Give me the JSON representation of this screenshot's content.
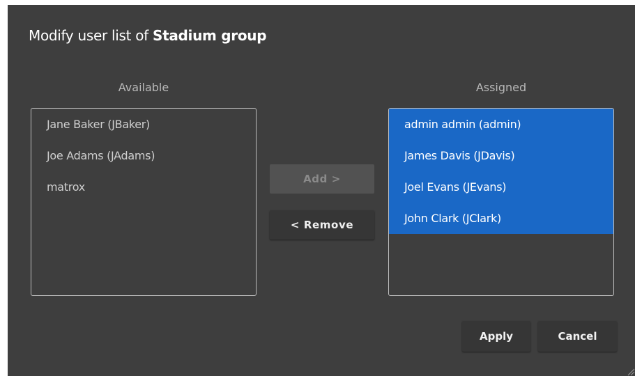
{
  "dialog": {
    "title_prefix": "Modify user list of ",
    "title_group": "Stadium group"
  },
  "available": {
    "header": "Available",
    "items": [
      "Jane Baker (JBaker)",
      "Joe Adams (JAdams)",
      "matrox"
    ]
  },
  "assigned": {
    "header": "Assigned",
    "items": [
      "admin admin (admin)",
      "James Davis (JDavis)",
      "Joel Evans (JEvans)",
      "John Clark (JClark)"
    ]
  },
  "buttons": {
    "add": "Add  >",
    "remove": "<  Remove",
    "apply": "Apply",
    "cancel": "Cancel"
  },
  "colors": {
    "dialog_bg": "#3e3e3e",
    "selection": "#1a68c6"
  }
}
